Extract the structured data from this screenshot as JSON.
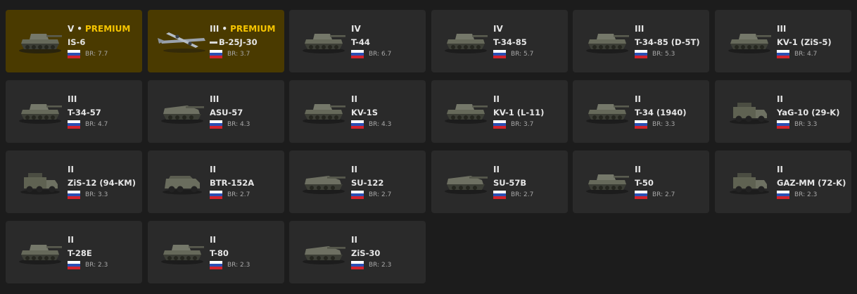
{
  "colors": {
    "page_bg": "#1c1c1c",
    "card_bg": "#2a2a2a",
    "premium_bg": "#4a3a00",
    "premium_text": "#f5c400",
    "flag": [
      "#ffffff",
      "#2a4fb5",
      "#d3212c"
    ]
  },
  "premium_label": "PREMIUM",
  "separator": "•",
  "vehicles": [
    {
      "tier": "V",
      "premium": true,
      "name": "IS-6",
      "br": "BR: 7.7",
      "icon": "tank-icon"
    },
    {
      "tier": "III",
      "premium": true,
      "name": "B-25J-30",
      "br": "BR: 3.7",
      "icon": "bomber-plane-icon",
      "marked": true
    },
    {
      "tier": "IV",
      "premium": false,
      "name": "T-44",
      "br": "BR: 6.7",
      "icon": "tank-icon"
    },
    {
      "tier": "IV",
      "premium": false,
      "name": "T-34-85",
      "br": "BR: 5.7",
      "icon": "tank-icon"
    },
    {
      "tier": "III",
      "premium": false,
      "name": "T-34-85 (D-5T)",
      "br": "BR: 5.3",
      "icon": "tank-icon"
    },
    {
      "tier": "III",
      "premium": false,
      "name": "KV-1 (ZiS-5)",
      "br": "BR: 4.7",
      "icon": "tank-icon"
    },
    {
      "tier": "III",
      "premium": false,
      "name": "T-34-57",
      "br": "BR: 4.7",
      "icon": "tank-icon"
    },
    {
      "tier": "III",
      "premium": false,
      "name": "ASU-57",
      "br": "BR: 4.3",
      "icon": "tank-destroyer-icon"
    },
    {
      "tier": "II",
      "premium": false,
      "name": "KV-1S",
      "br": "BR: 4.3",
      "icon": "tank-icon"
    },
    {
      "tier": "II",
      "premium": false,
      "name": "KV-1 (L-11)",
      "br": "BR: 3.7",
      "icon": "tank-icon"
    },
    {
      "tier": "II",
      "premium": false,
      "name": "T-34 (1940)",
      "br": "BR: 3.3",
      "icon": "tank-icon"
    },
    {
      "tier": "II",
      "premium": false,
      "name": "YaG-10 (29-K)",
      "br": "BR: 3.3",
      "icon": "truck-icon"
    },
    {
      "tier": "II",
      "premium": false,
      "name": "ZiS-12 (94-KM)",
      "br": "BR: 3.3",
      "icon": "truck-icon"
    },
    {
      "tier": "II",
      "premium": false,
      "name": "BTR-152A",
      "br": "BR: 2.7",
      "icon": "armored-car-icon"
    },
    {
      "tier": "II",
      "premium": false,
      "name": "SU-122",
      "br": "BR: 2.7",
      "icon": "tank-destroyer-icon"
    },
    {
      "tier": "II",
      "premium": false,
      "name": "SU-57B",
      "br": "BR: 2.7",
      "icon": "tank-destroyer-icon"
    },
    {
      "tier": "II",
      "premium": false,
      "name": "T-50",
      "br": "BR: 2.7",
      "icon": "tank-icon"
    },
    {
      "tier": "II",
      "premium": false,
      "name": "GAZ-MM (72-K)",
      "br": "BR: 2.3",
      "icon": "truck-icon"
    },
    {
      "tier": "II",
      "premium": false,
      "name": "T-28E",
      "br": "BR: 2.3",
      "icon": "tank-icon"
    },
    {
      "tier": "II",
      "premium": false,
      "name": "T-80",
      "br": "BR: 2.3",
      "icon": "tank-icon"
    },
    {
      "tier": "II",
      "premium": false,
      "name": "ZiS-30",
      "br": "BR: 2.3",
      "icon": "tank-destroyer-icon"
    }
  ]
}
